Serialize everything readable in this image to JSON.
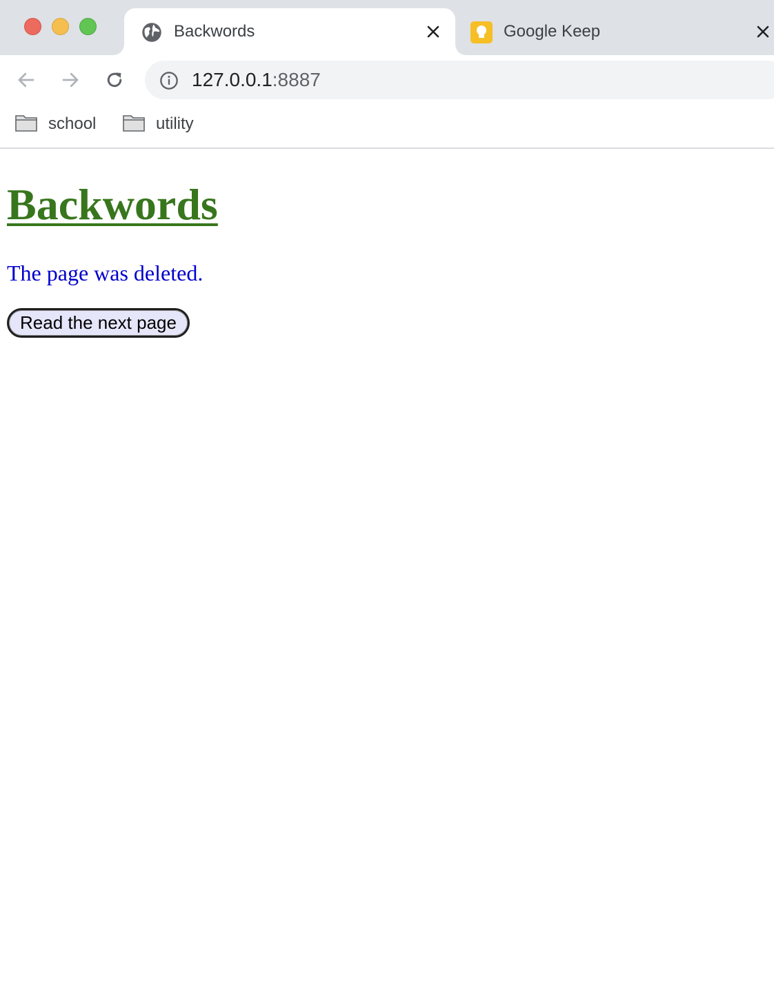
{
  "browser": {
    "tabs": [
      {
        "title": "Backwords",
        "favicon": "globe-icon",
        "active": true
      },
      {
        "title": "Google Keep",
        "favicon": "google-keep-icon",
        "active": false
      }
    ],
    "address_bar": {
      "host": "127.0.0.1",
      "port": ":8887"
    },
    "bookmarks": [
      {
        "label": "school",
        "icon": "folder-icon"
      },
      {
        "label": "utility",
        "icon": "folder-icon"
      }
    ]
  },
  "page": {
    "title": "Backwords",
    "message": "The page was deleted.",
    "next_button_label": "Read the next page"
  },
  "colors": {
    "title": "#38761d",
    "message": "#0000cc",
    "button_bg": "#e6e6fa",
    "tab_strip": "#dee1e6"
  }
}
